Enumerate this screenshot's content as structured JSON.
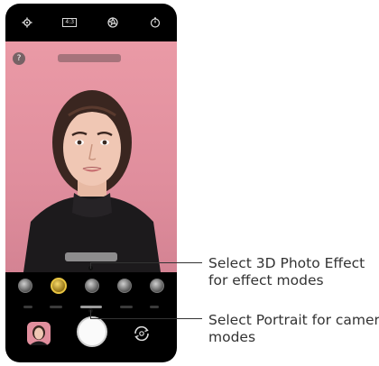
{
  "topbar": {
    "ratio_label": "4:3"
  },
  "viewfinder": {
    "help_label": "?"
  },
  "callouts": {
    "effect": {
      "line1": "Select 3D Photo Effect",
      "line2": "for effect modes"
    },
    "mode": {
      "line1": "Select Portrait for camera",
      "line2": "modes"
    }
  },
  "colors": {
    "background_pink": "#e08e9d",
    "selected_effect": "#e9c542",
    "phone_body": "#000000"
  },
  "icons": {
    "settings": "gear-icon",
    "ratio": "aspect-ratio-icon",
    "filter": "aperture-icon",
    "timer": "timer-icon",
    "switch_camera": "camera-switch-icon"
  }
}
